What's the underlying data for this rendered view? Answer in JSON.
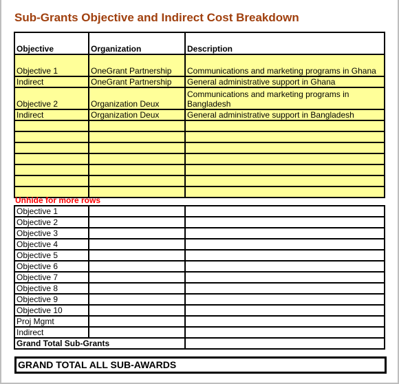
{
  "title": "Sub-Grants Objective and Indirect Cost Breakdown",
  "table1": {
    "headers": {
      "objective": "Objective",
      "organization": "Organization",
      "description": "Description"
    },
    "rows": [
      {
        "objective": "Objective 1",
        "organization": "OneGrant Partnership",
        "description": "Communications and marketing programs in Ghana"
      },
      {
        "objective": "Indirect",
        "organization": "OneGrant Partnership",
        "description": "General administrative support in Ghana"
      },
      {
        "objective": "Objective 2",
        "organization": "Organization Deux",
        "description": "Communications and marketing programs in Bangladesh"
      },
      {
        "objective": "Indirect",
        "organization": "Organization Deux",
        "description": "General administrative support in Bangladesh"
      }
    ],
    "empty_rows": 7,
    "fill_color": "#ffff99"
  },
  "unhide_note": "Unhide for more rows",
  "table2": {
    "rows": [
      "Objective 1",
      "Objective 2",
      "Objective 3",
      "Objective 4",
      "Objective 5",
      "Objective 6",
      "Objective 7",
      "Objective 8",
      "Objective 9",
      "Objective 10",
      "Proj Mgmt",
      "Indirect"
    ],
    "total_label": "Grand Total Sub-Grants"
  },
  "grand_total_label": "GRAND TOTAL ALL SUB-AWARDS",
  "colors": {
    "title": "#a0400e",
    "note": "#ff0000"
  }
}
